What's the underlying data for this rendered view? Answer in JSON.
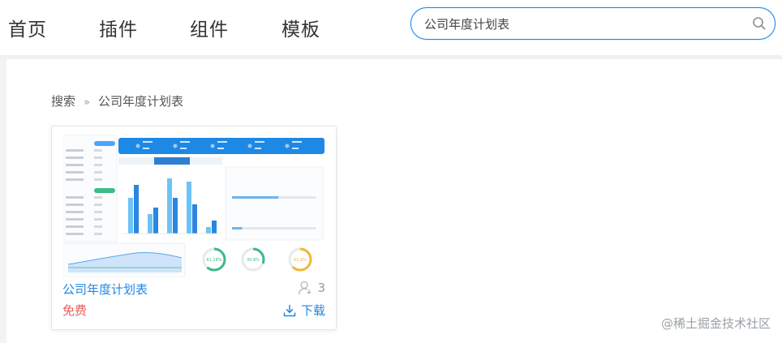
{
  "nav": {
    "items": [
      {
        "label": "首页"
      },
      {
        "label": "插件"
      },
      {
        "label": "组件"
      },
      {
        "label": "模板"
      }
    ]
  },
  "search": {
    "value": "公司年度计划表",
    "icon": "search-icon"
  },
  "breadcrumb": {
    "root": "搜索",
    "separator": "»",
    "current": "公司年度计划表"
  },
  "card": {
    "title": "公司年度计划表",
    "user_count": "3",
    "price": "免费",
    "download_label": "下载",
    "thumbnail": {
      "bar_values": [
        0.55,
        0.75,
        0.3,
        0.4,
        0.85,
        0.55,
        0.8,
        0.45,
        0.1,
        0.2
      ],
      "gauges": [
        {
          "label": "61.18%",
          "color": "#3cba87",
          "fraction": 0.61
        },
        {
          "label": "30.8%",
          "color": "#3cba87",
          "fraction": 0.31
        },
        {
          "label": "61.9%",
          "color": "#f3b738",
          "fraction": 0.62
        }
      ],
      "progress_values": [
        0.55,
        0.12
      ]
    }
  },
  "watermark": "@稀土掘金技术社区",
  "colors": {
    "accent": "#1e88e5",
    "price": "#e95d5d"
  }
}
